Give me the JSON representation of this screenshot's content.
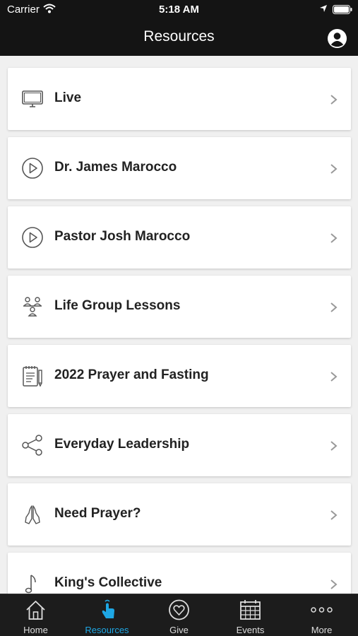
{
  "status_bar": {
    "carrier": "Carrier",
    "time": "5:18 AM"
  },
  "header": {
    "title": "Resources"
  },
  "items": [
    {
      "label": "Live",
      "icon": "tv-monitor-icon"
    },
    {
      "label": "Dr. James Marocco",
      "icon": "play-circle-icon"
    },
    {
      "label": "Pastor Josh Marocco",
      "icon": "play-circle-icon"
    },
    {
      "label": "Life Group Lessons",
      "icon": "group-people-icon"
    },
    {
      "label": "2022 Prayer and Fasting",
      "icon": "notepad-pen-icon"
    },
    {
      "label": "Everyday Leadership",
      "icon": "share-nodes-icon"
    },
    {
      "label": "Need Prayer?",
      "icon": "praying-hands-icon"
    },
    {
      "label": "King's Collective",
      "icon": "music-note-icon"
    }
  ],
  "tabs": [
    {
      "label": "Home",
      "icon": "home-icon",
      "active": false
    },
    {
      "label": "Resources",
      "icon": "touch-hand-icon",
      "active": true
    },
    {
      "label": "Give",
      "icon": "heart-circle-icon",
      "active": false
    },
    {
      "label": "Events",
      "icon": "calendar-icon",
      "active": false
    },
    {
      "label": "More",
      "icon": "more-dots-icon",
      "active": false
    }
  ],
  "colors": {
    "header_bg": "#141414",
    "tab_active": "#1ea7e4",
    "tab_bar_bg": "#1c1c1c"
  }
}
